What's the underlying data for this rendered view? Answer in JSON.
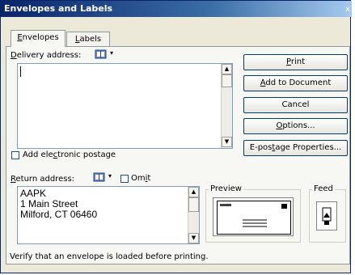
{
  "window": {
    "title": "Envelopes and Labels",
    "close_glyph": "x"
  },
  "tabs": [
    {
      "label": "Envelopes",
      "mnemonic": "E",
      "rest": "nvelopes",
      "selected": true
    },
    {
      "label": "Labels",
      "mnemonic": "L",
      "rest": "abels",
      "selected": false
    }
  ],
  "delivery": {
    "label_mn": "D",
    "label_rest": "elivery address:",
    "address_icon": "address-book-icon",
    "value": ""
  },
  "postage": {
    "pre": "Add ele",
    "mn": "c",
    "post": "tronic postage",
    "checked": false
  },
  "buttons": {
    "print": {
      "mn": "P",
      "rest": "rint"
    },
    "add": {
      "mn": "A",
      "rest": "dd to Document"
    },
    "cancel": {
      "label": "Cancel"
    },
    "options": {
      "mn": "O",
      "rest": "ptions..."
    },
    "postage_props": {
      "pre": "E-pos",
      "mn": "t",
      "post": "age Properties..."
    }
  },
  "return": {
    "label_mn": "R",
    "label_rest": "eturn address:",
    "omit": {
      "pre": "Om",
      "mn": "i",
      "post": "t",
      "checked": false
    },
    "lines": [
      "AAPK",
      "1 Main Street",
      "Milford, CT 06460"
    ]
  },
  "preview": {
    "label": "Preview"
  },
  "feed": {
    "label": "Feed"
  },
  "footer": {
    "hint": "Verify that an envelope is loaded before printing."
  },
  "colors": {
    "titlebar": "#0a246a",
    "face": "#ece9d8",
    "panel": "#f7f7f4",
    "border": "#919b9c"
  }
}
